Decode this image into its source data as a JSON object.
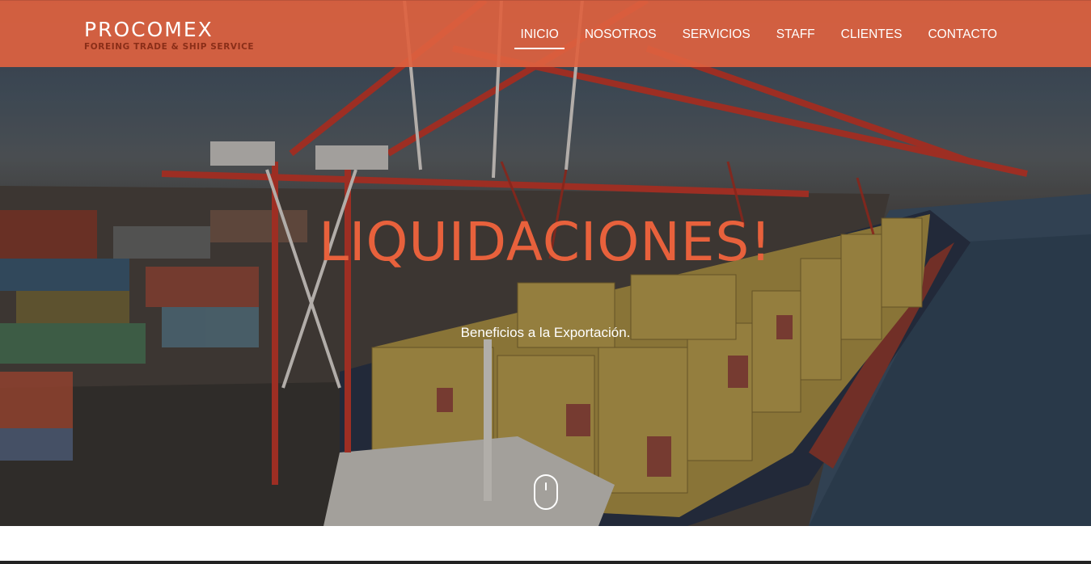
{
  "brand": {
    "name": "PROCOMEX",
    "tagline": "FOREING TRADE & SHIP SERVICE",
    "accent_color": "#de6240",
    "tagline_color": "#8a2e18"
  },
  "nav": {
    "items": [
      {
        "label": "INICIO",
        "active": true
      },
      {
        "label": "NOSOTROS",
        "active": false
      },
      {
        "label": "SERVICIOS",
        "active": false
      },
      {
        "label": "STAFF",
        "active": false
      },
      {
        "label": "CLIENTES",
        "active": false
      },
      {
        "label": "CONTACTO",
        "active": false
      }
    ]
  },
  "hero": {
    "title": "LIQUIDACIONES!",
    "subtitle": "Beneficios a la Exportación.",
    "background": "container port with cranes and cargo ship",
    "title_color": "#e8613c",
    "scroll_icon": "mouse-scroll-icon"
  }
}
